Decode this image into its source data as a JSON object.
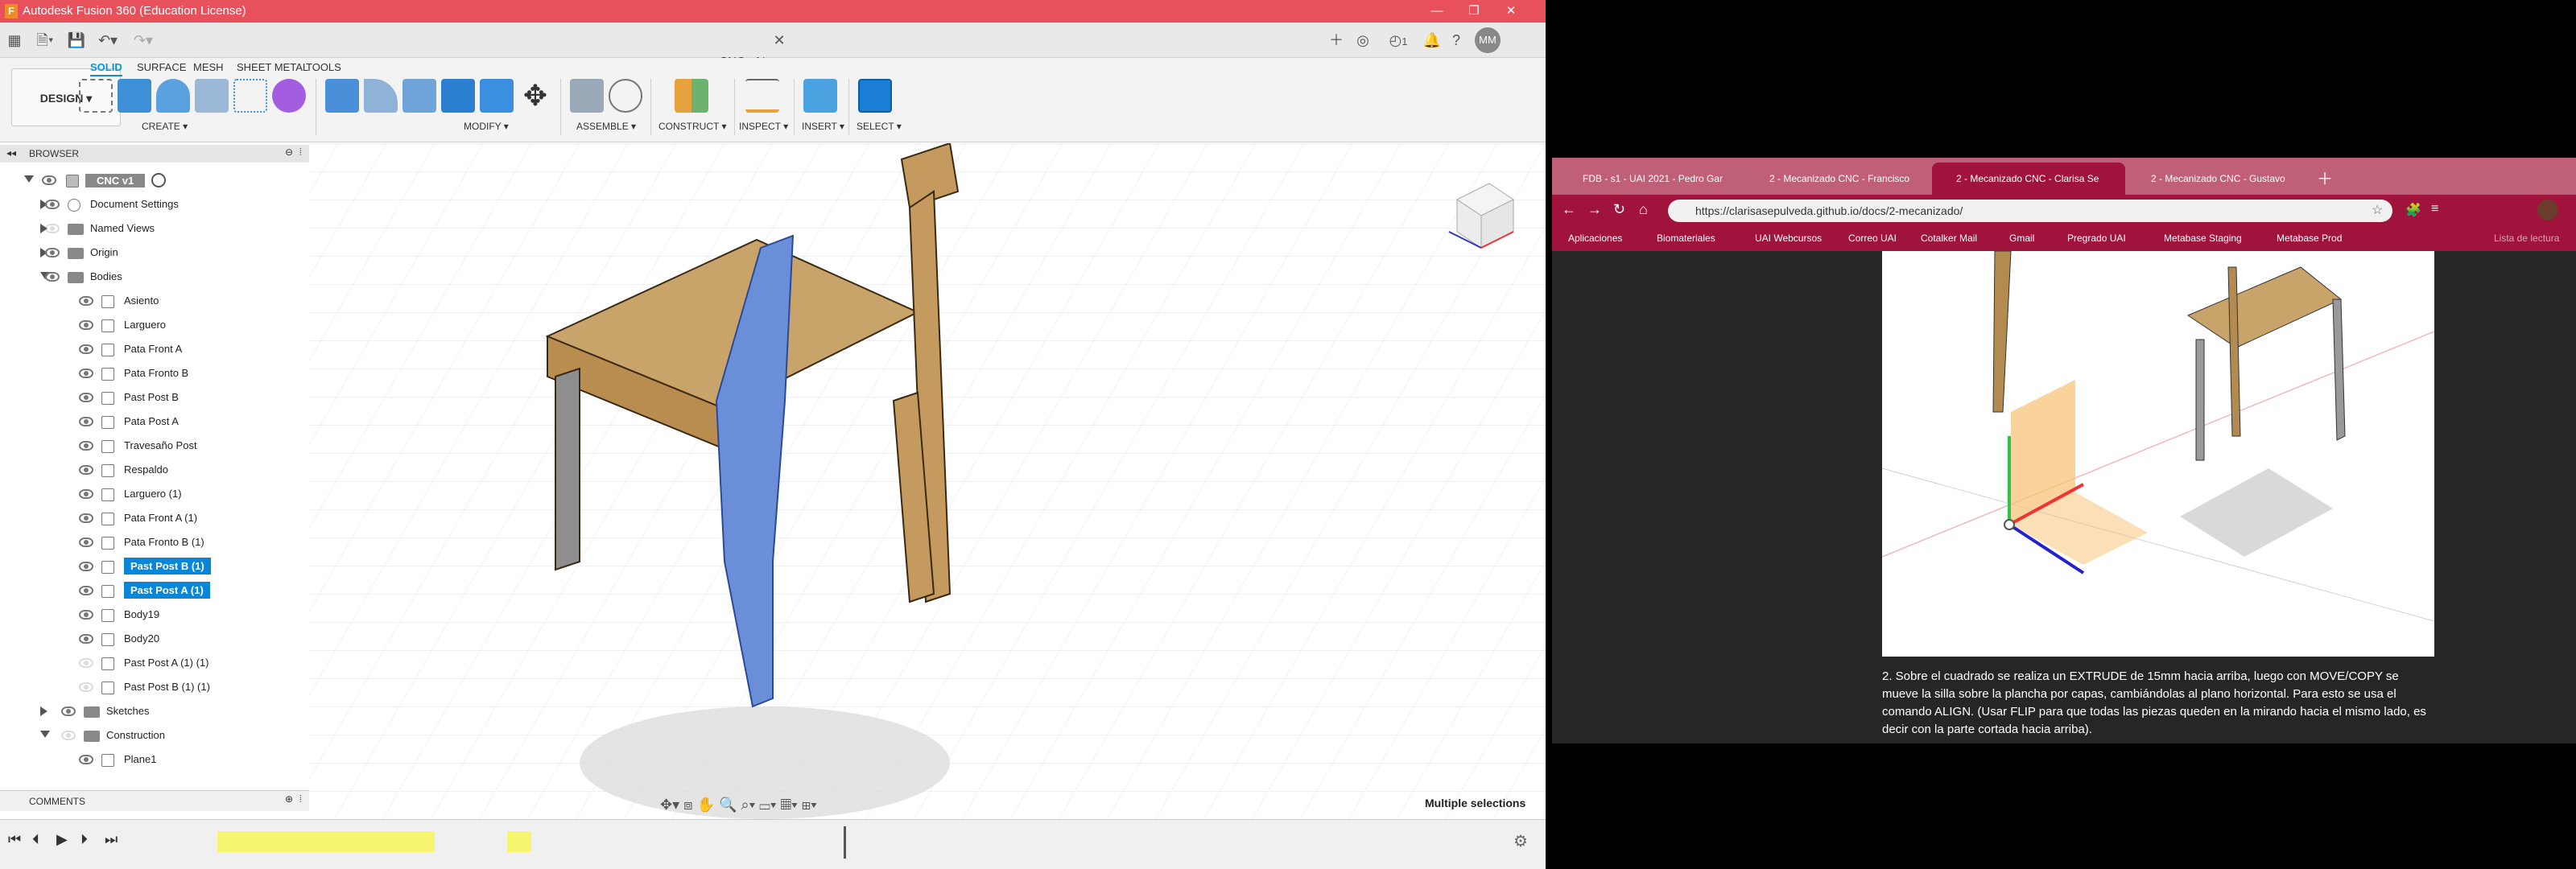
{
  "fusion": {
    "title": "Autodesk Fusion 360 (Education License)",
    "doc_tab": "CNC v1*",
    "ribbon_tabs": [
      "SOLID",
      "SURFACE",
      "MESH",
      "SHEET METAL",
      "TOOLS"
    ],
    "design_button": "DESIGN ▾",
    "groups": [
      "CREATE ▾",
      "MODIFY ▾",
      "ASSEMBLE ▾",
      "CONSTRUCT ▾",
      "INSPECT ▾",
      "INSERT ▾",
      "SELECT ▾"
    ],
    "browser_title": "BROWSER",
    "root": "CNC v1",
    "tree_top": [
      "Document Settings",
      "Named Views",
      "Origin",
      "Bodies"
    ],
    "bodies": [
      {
        "label": "Asiento",
        "selected": false
      },
      {
        "label": "Larguero",
        "selected": false
      },
      {
        "label": "Pata Front A",
        "selected": false
      },
      {
        "label": "Pata Fronto B",
        "selected": false
      },
      {
        "label": "Past Post B",
        "selected": false
      },
      {
        "label": "Pata Post A",
        "selected": false
      },
      {
        "label": "Travesaño Post",
        "selected": false
      },
      {
        "label": "Respaldo",
        "selected": false
      },
      {
        "label": "Larguero (1)",
        "selected": false
      },
      {
        "label": "Pata Front A (1)",
        "selected": false
      },
      {
        "label": "Pata Fronto B (1)",
        "selected": false
      },
      {
        "label": "Past Post B (1)",
        "selected": true
      },
      {
        "label": "Past Post A (1)",
        "selected": true
      },
      {
        "label": "Body19",
        "selected": false
      },
      {
        "label": "Body20",
        "selected": false
      },
      {
        "label": "Past Post A (1) (1)",
        "selected": false
      },
      {
        "label": "Past Post B (1) (1)",
        "selected": false
      }
    ],
    "tree_bottom": [
      "Sketches",
      "Construction",
      "Plane1"
    ],
    "comments": "COMMENTS",
    "status": "Multiple selections",
    "notifications": "1",
    "user": "MM"
  },
  "chrome": {
    "tabs": [
      "FDB - s1 - UAI 2021 - Pedro Gar",
      "2 - Mecanizado CNC - Francisco",
      "2 - Mecanizado CNC - Clarisa Se",
      "2 - Mecanizado CNC - Gustavo"
    ],
    "url": "https://clarisasepulveda.github.io/docs/2-mecanizado/",
    "bookmarks": [
      "Aplicaciones",
      "Biomateriales",
      "UAI Webcursos",
      "Correo UAI",
      "Cotalker Mail",
      "Gmail",
      "Pregrado UAI",
      "Metabase Staging",
      "Metabase Prod"
    ],
    "reading_list": "Lista de lectura",
    "paragraph": "2. Sobre el cuadrado se realiza un EXTRUDE de 15mm hacia arriba, luego con MOVE/COPY se mueve la silla sobre la plancha por capas, cambiándolas al plano horizontal. Para esto se usa el comando ALIGN. (Usar FLIP para que todas las piezas queden en la mirando hacia el mismo lado, es decir con la parte cortada hacia arriba)."
  },
  "colors": {
    "title_bar": "#e8505b",
    "selection": "#0a86d8",
    "chrome_accent": "#a0133c"
  }
}
